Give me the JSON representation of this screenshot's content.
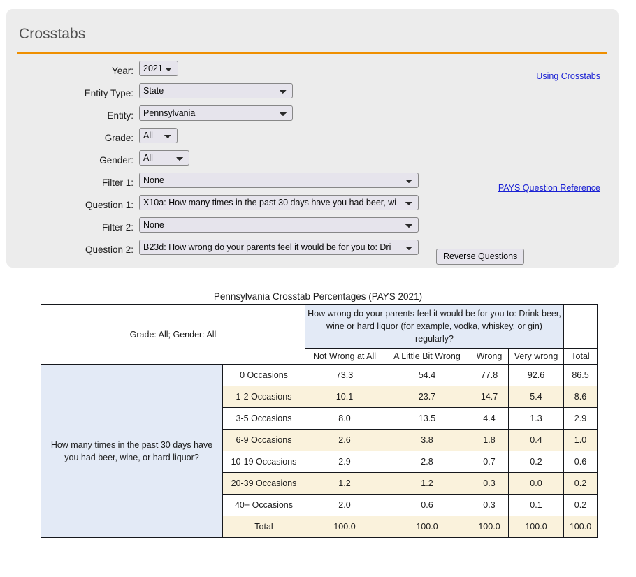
{
  "panel": {
    "title": "Crosstabs",
    "accent_color": "#ef8f00",
    "background_color": "#ececec"
  },
  "links": {
    "using_crosstabs": "Using Crosstabs",
    "pays_question_reference": "PAYS Question Reference"
  },
  "buttons": {
    "reverse_questions": "Reverse Questions"
  },
  "form": {
    "year": {
      "label": "Year:",
      "value": "2021",
      "options": [
        "2021"
      ]
    },
    "entity_type": {
      "label": "Entity Type:",
      "value": "State",
      "options": [
        "State"
      ]
    },
    "entity": {
      "label": "Entity:",
      "value": "Pennsylvania",
      "options": [
        "Pennsylvania"
      ]
    },
    "grade": {
      "label": "Grade:",
      "value": "All",
      "options": [
        "All"
      ]
    },
    "gender": {
      "label": "Gender:",
      "value": "All",
      "options": [
        "All"
      ]
    },
    "filter1": {
      "label": "Filter 1:",
      "value": "None",
      "options": [
        "None"
      ]
    },
    "question1": {
      "label": "Question 1:",
      "value": "X10a: How many times in the past 30 days have you had beer, wi",
      "options": [
        "X10a: How many times in the past 30 days have you had beer, wi"
      ]
    },
    "filter2": {
      "label": "Filter 2:",
      "value": "None",
      "options": [
        "None"
      ]
    },
    "question2": {
      "label": "Question 2:",
      "value": "B23d: How wrong do your parents feel it would be for you to: Dri",
      "options": [
        "B23d: How wrong do your parents feel it would be for you to: Dri"
      ]
    }
  },
  "table": {
    "title": "Pennsylvania Crosstab Percentages (PAYS 2021)",
    "meta": "Grade: All; Gender: All",
    "column_question": "How wrong do your parents feel it would be for you to: Drink beer, wine or hard liquor (for example, vodka, whiskey, or gin) regularly?",
    "row_question": "How many times in the past 30 days have you had beer, wine, or hard liquor?",
    "column_headers": [
      "Not Wrong at All",
      "A Little Bit Wrong",
      "Wrong",
      "Very wrong",
      "Total"
    ],
    "rows": [
      {
        "label": "0 Occasions",
        "values": [
          "73.3",
          "54.4",
          "77.8",
          "92.6",
          "86.5"
        ]
      },
      {
        "label": "1-2 Occasions",
        "values": [
          "10.1",
          "23.7",
          "14.7",
          "5.4",
          "8.6"
        ]
      },
      {
        "label": "3-5 Occasions",
        "values": [
          "8.0",
          "13.5",
          "4.4",
          "1.3",
          "2.9"
        ]
      },
      {
        "label": "6-9 Occasions",
        "values": [
          "2.6",
          "3.8",
          "1.8",
          "0.4",
          "1.0"
        ]
      },
      {
        "label": "10-19 Occasions",
        "values": [
          "2.9",
          "2.8",
          "0.7",
          "0.2",
          "0.6"
        ]
      },
      {
        "label": "20-39 Occasions",
        "values": [
          "1.2",
          "1.2",
          "0.3",
          "0.0",
          "0.2"
        ]
      },
      {
        "label": "40+ Occasions",
        "values": [
          "2.0",
          "0.6",
          "0.3",
          "0.1",
          "0.2"
        ]
      },
      {
        "label": "Total",
        "values": [
          "100.0",
          "100.0",
          "100.0",
          "100.0",
          "100.0"
        ]
      }
    ]
  },
  "chart_data": {
    "type": "table",
    "title": "Pennsylvania Crosstab Percentages (PAYS 2021)",
    "xlabel": "How wrong do your parents feel it would be for you to: Drink beer, wine or hard liquor (for example, vodka, whiskey, or gin) regularly?",
    "ylabel": "How many times in the past 30 days have you had beer, wine, or hard liquor?",
    "categories": [
      "Not Wrong at All",
      "A Little Bit Wrong",
      "Wrong",
      "Very wrong",
      "Total"
    ],
    "row_categories": [
      "0 Occasions",
      "1-2 Occasions",
      "3-5 Occasions",
      "6-9 Occasions",
      "10-19 Occasions",
      "20-39 Occasions",
      "40+ Occasions",
      "Total"
    ],
    "series": [
      {
        "name": "0 Occasions",
        "values": [
          73.3,
          54.4,
          77.8,
          92.6,
          86.5
        ]
      },
      {
        "name": "1-2 Occasions",
        "values": [
          10.1,
          23.7,
          14.7,
          5.4,
          8.6
        ]
      },
      {
        "name": "3-5 Occasions",
        "values": [
          8.0,
          13.5,
          4.4,
          1.3,
          2.9
        ]
      },
      {
        "name": "6-9 Occasions",
        "values": [
          2.6,
          3.8,
          1.8,
          0.4,
          1.0
        ]
      },
      {
        "name": "10-19 Occasions",
        "values": [
          2.9,
          2.8,
          0.7,
          0.2,
          0.6
        ]
      },
      {
        "name": "20-39 Occasions",
        "values": [
          1.2,
          1.2,
          0.3,
          0.0,
          0.2
        ]
      },
      {
        "name": "40+ Occasions",
        "values": [
          2.0,
          0.6,
          0.3,
          0.1,
          0.2
        ]
      },
      {
        "name": "Total",
        "values": [
          100.0,
          100.0,
          100.0,
          100.0,
          100.0
        ]
      }
    ]
  }
}
